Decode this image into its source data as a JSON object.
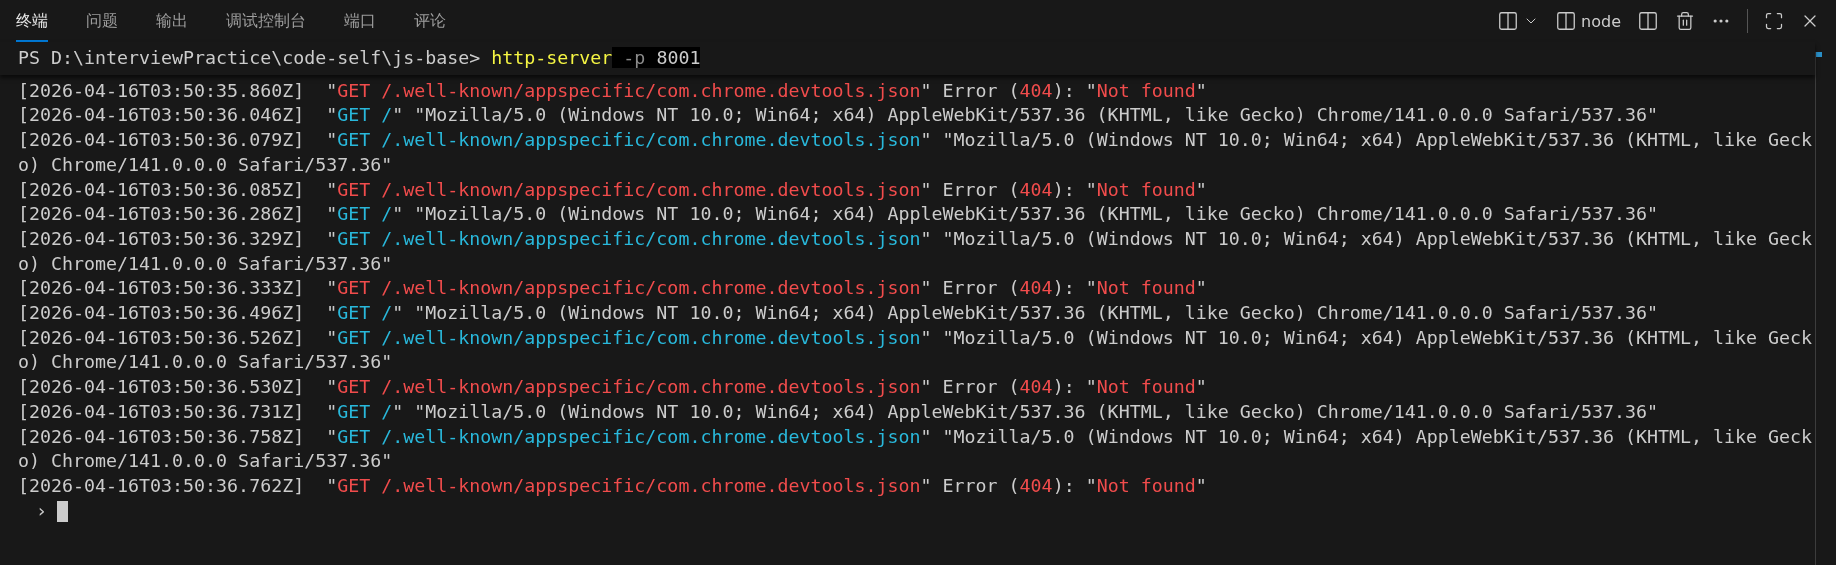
{
  "tabs": [
    {
      "label": "终端",
      "selected": true
    },
    {
      "label": "问题",
      "selected": false
    },
    {
      "label": "输出",
      "selected": false
    },
    {
      "label": "调试控制台",
      "selected": false
    },
    {
      "label": "端口",
      "selected": false
    },
    {
      "label": "评论",
      "selected": false
    }
  ],
  "toolbar": {
    "terminal_name": "node"
  },
  "prompt": [
    {
      "text": "PS D:\\interviewPractice\\code-self\\js-base> ",
      "kind": "plain",
      "selected": false
    },
    {
      "text": "http-server",
      "kind": "command",
      "selected": false
    },
    {
      "text": " -p",
      "kind": "flag",
      "selected": true
    },
    {
      "text": " 8001",
      "kind": "plain",
      "selected": true
    }
  ],
  "log": [
    [
      {
        "text": "[2026-04-16T03:50:35.860Z]  \"",
        "kind": "plain"
      },
      {
        "text": "GET /.well-known/appspecific/com.chrome.devtools.json",
        "kind": "error"
      },
      {
        "text": "\" Error (",
        "kind": "plain"
      },
      {
        "text": "404",
        "kind": "error"
      },
      {
        "text": "): \"",
        "kind": "plain"
      },
      {
        "text": "Not found",
        "kind": "error"
      },
      {
        "text": "\"",
        "kind": "plain"
      }
    ],
    [
      {
        "text": "[2026-04-16T03:50:36.046Z]  \"",
        "kind": "plain"
      },
      {
        "text": "GET /",
        "kind": "info"
      },
      {
        "text": "\" \"Mozilla/5.0 (Windows NT 10.0; Win64; x64) AppleWebKit/537.36 (KHTML, like Gecko) Chrome/141.0.0.0 Safari/537.36\"",
        "kind": "plain"
      }
    ],
    [
      {
        "text": "[2026-04-16T03:50:36.079Z]  \"",
        "kind": "plain"
      },
      {
        "text": "GET /.well-known/appspecific/com.chrome.devtools.json",
        "kind": "info"
      },
      {
        "text": "\" \"Mozilla/5.0 (Windows NT 10.0; Win64; x64) AppleWebKit/537.36 (KHTML, like Gecko) Chrome/141.0.0.0 Safari/537.36\"",
        "kind": "plain"
      }
    ],
    [
      {
        "text": "[2026-04-16T03:50:36.085Z]  \"",
        "kind": "plain"
      },
      {
        "text": "GET /.well-known/appspecific/com.chrome.devtools.json",
        "kind": "error"
      },
      {
        "text": "\" Error (",
        "kind": "plain"
      },
      {
        "text": "404",
        "kind": "error"
      },
      {
        "text": "): \"",
        "kind": "plain"
      },
      {
        "text": "Not found",
        "kind": "error"
      },
      {
        "text": "\"",
        "kind": "plain"
      }
    ],
    [
      {
        "text": "[2026-04-16T03:50:36.286Z]  \"",
        "kind": "plain"
      },
      {
        "text": "GET /",
        "kind": "info"
      },
      {
        "text": "\" \"Mozilla/5.0 (Windows NT 10.0; Win64; x64) AppleWebKit/537.36 (KHTML, like Gecko) Chrome/141.0.0.0 Safari/537.36\"",
        "kind": "plain"
      }
    ],
    [
      {
        "text": "[2026-04-16T03:50:36.329Z]  \"",
        "kind": "plain"
      },
      {
        "text": "GET /.well-known/appspecific/com.chrome.devtools.json",
        "kind": "info"
      },
      {
        "text": "\" \"Mozilla/5.0 (Windows NT 10.0; Win64; x64) AppleWebKit/537.36 (KHTML, like Gecko) Chrome/141.0.0.0 Safari/537.36\"",
        "kind": "plain"
      }
    ],
    [
      {
        "text": "[2026-04-16T03:50:36.333Z]  \"",
        "kind": "plain"
      },
      {
        "text": "GET /.well-known/appspecific/com.chrome.devtools.json",
        "kind": "error"
      },
      {
        "text": "\" Error (",
        "kind": "plain"
      },
      {
        "text": "404",
        "kind": "error"
      },
      {
        "text": "): \"",
        "kind": "plain"
      },
      {
        "text": "Not found",
        "kind": "error"
      },
      {
        "text": "\"",
        "kind": "plain"
      }
    ],
    [
      {
        "text": "[2026-04-16T03:50:36.496Z]  \"",
        "kind": "plain"
      },
      {
        "text": "GET /",
        "kind": "info"
      },
      {
        "text": "\" \"Mozilla/5.0 (Windows NT 10.0; Win64; x64) AppleWebKit/537.36 (KHTML, like Gecko) Chrome/141.0.0.0 Safari/537.36\"",
        "kind": "plain"
      }
    ],
    [
      {
        "text": "[2026-04-16T03:50:36.526Z]  \"",
        "kind": "plain"
      },
      {
        "text": "GET /.well-known/appspecific/com.chrome.devtools.json",
        "kind": "info"
      },
      {
        "text": "\" \"Mozilla/5.0 (Windows NT 10.0; Win64; x64) AppleWebKit/537.36 (KHTML, like Gecko) Chrome/141.0.0.0 Safari/537.36\"",
        "kind": "plain"
      }
    ],
    [
      {
        "text": "[2026-04-16T03:50:36.530Z]  \"",
        "kind": "plain"
      },
      {
        "text": "GET /.well-known/appspecific/com.chrome.devtools.json",
        "kind": "error"
      },
      {
        "text": "\" Error (",
        "kind": "plain"
      },
      {
        "text": "404",
        "kind": "error"
      },
      {
        "text": "): \"",
        "kind": "plain"
      },
      {
        "text": "Not found",
        "kind": "error"
      },
      {
        "text": "\"",
        "kind": "plain"
      }
    ],
    [
      {
        "text": "[2026-04-16T03:50:36.731Z]  \"",
        "kind": "plain"
      },
      {
        "text": "GET /",
        "kind": "info"
      },
      {
        "text": "\" \"Mozilla/5.0 (Windows NT 10.0; Win64; x64) AppleWebKit/537.36 (KHTML, like Gecko) Chrome/141.0.0.0 Safari/537.36\"",
        "kind": "plain"
      }
    ],
    [
      {
        "text": "[2026-04-16T03:50:36.758Z]  \"",
        "kind": "plain"
      },
      {
        "text": "GET /.well-known/appspecific/com.chrome.devtools.json",
        "kind": "info"
      },
      {
        "text": "\" \"Mozilla/5.0 (Windows NT 10.0; Win64; x64) AppleWebKit/537.36 (KHTML, like Gecko) Chrome/141.0.0.0 Safari/537.36\"",
        "kind": "plain"
      }
    ],
    [
      {
        "text": "[2026-04-16T03:50:36.762Z]  \"",
        "kind": "plain"
      },
      {
        "text": "GET /.well-known/appspecific/com.chrome.devtools.json",
        "kind": "error"
      },
      {
        "text": "\" Error (",
        "kind": "plain"
      },
      {
        "text": "404",
        "kind": "error"
      },
      {
        "text": "): \"",
        "kind": "plain"
      },
      {
        "text": "Not found",
        "kind": "error"
      },
      {
        "text": "\"",
        "kind": "plain"
      }
    ]
  ],
  "input_prompt": "›"
}
